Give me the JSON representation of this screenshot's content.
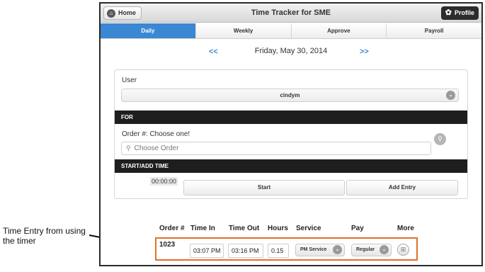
{
  "annotation": {
    "text": "Time Entry from using the timer"
  },
  "topbar": {
    "home_label": "Home",
    "title": "Time Tracker for SME",
    "profile_label": "Profile"
  },
  "tabs": [
    {
      "label": "Daily",
      "active": true
    },
    {
      "label": "Weekly",
      "active": false
    },
    {
      "label": "Approve",
      "active": false
    },
    {
      "label": "Payroll",
      "active": false
    }
  ],
  "date_nav": {
    "prev": "<<",
    "date": "Friday, May 30, 2014",
    "next": ">>"
  },
  "user": {
    "label": "User",
    "selected": "cindym"
  },
  "for_section": {
    "header": "FOR",
    "order_label": "Order #: Choose one!",
    "order_placeholder": "Choose Order"
  },
  "time_section": {
    "header": "START/ADD TIME",
    "timer": "00:00:00",
    "start_label": "Start",
    "add_entry_label": "Add Entry"
  },
  "entries_table": {
    "columns": [
      "Order #",
      "Time In",
      "Time Out",
      "Hours",
      "Service",
      "Pay",
      "More"
    ],
    "rows": [
      {
        "order": "1023",
        "time_in": "03:07 PM",
        "time_out": "03:16 PM",
        "hours": "0.15",
        "service": "PM Service",
        "pay": "Regular"
      }
    ]
  },
  "colors": {
    "accent": "#3a87d4",
    "highlight": "#e0712a",
    "section_bg": "#1e1e1e"
  }
}
